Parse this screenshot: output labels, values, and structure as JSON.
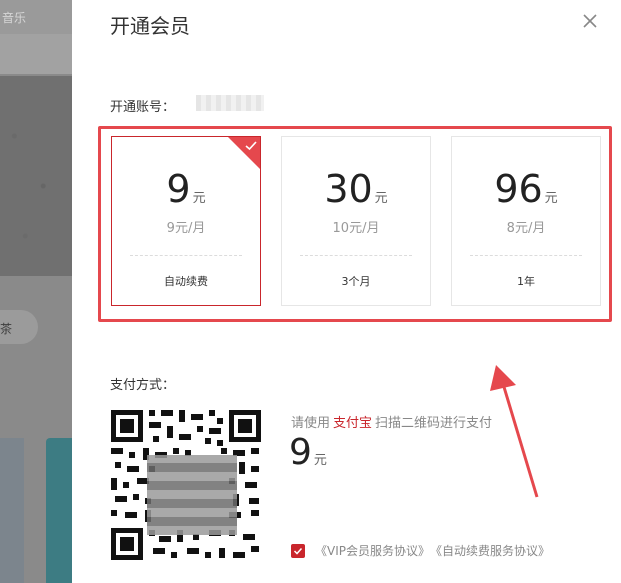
{
  "background_app": {
    "title_fragment": "音乐",
    "pill_text": "茶"
  },
  "modal": {
    "title": "开通会员",
    "account_label": "开通账号：",
    "plans": [
      {
        "price": "9",
        "unit": "元",
        "monthly": "9元/月",
        "period": "自动续费",
        "selected": true
      },
      {
        "price": "30",
        "unit": "元",
        "monthly": "10元/月",
        "period": "3个月",
        "selected": false
      },
      {
        "price": "96",
        "unit": "元",
        "monthly": "8元/月",
        "period": "1年",
        "selected": false
      }
    ],
    "payment": {
      "label": "支付方式：",
      "hint_prefix": "请使用",
      "hint_method": "支付宝",
      "hint_suffix": "扫描二维码进行支付",
      "amount": "9",
      "amount_unit": "元"
    },
    "agreement": {
      "link1": "《VIP会员服务协议》",
      "link2": "《自动续费服务协议》"
    }
  },
  "colors": {
    "accent": "#c9262c",
    "annotation": "#e5484d"
  }
}
